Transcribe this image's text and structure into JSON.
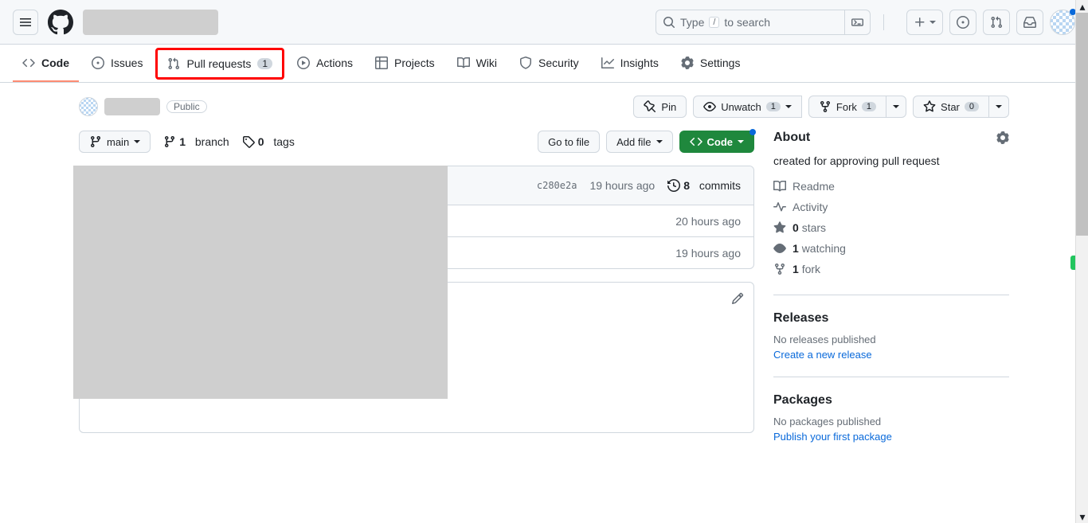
{
  "topbar": {
    "search_placeholder": "Type",
    "search_suffix": "to search",
    "search_key": "/"
  },
  "nav": {
    "code": "Code",
    "issues": "Issues",
    "pulls": "Pull requests",
    "pulls_count": "1",
    "actions": "Actions",
    "projects": "Projects",
    "wiki": "Wiki",
    "security": "Security",
    "insights": "Insights",
    "settings": "Settings"
  },
  "repo": {
    "visibility": "Public",
    "pin": "Pin",
    "unwatch": "Unwatch",
    "unwatch_count": "1",
    "fork": "Fork",
    "fork_count": "1",
    "star": "Star",
    "star_count": "0"
  },
  "toolbar": {
    "branch": "main",
    "branches_n": "1",
    "branches": "branch",
    "tags_n": "0",
    "tags": "tags",
    "goto": "Go to file",
    "addfile": "Add file",
    "code": "Code"
  },
  "commits": {
    "sha": "c280e2a",
    "time": "19 hours ago",
    "count": "8",
    "label": "commits"
  },
  "rows": {
    "r1_time": "20 hours ago",
    "r2_time": "19 hours ago"
  },
  "about": {
    "title": "About",
    "description": "created for approving pull request",
    "readme": "Readme",
    "activity": "Activity",
    "stars_n": "0",
    "stars": "stars",
    "watch_n": "1",
    "watch": "watching",
    "forks_n": "1",
    "forks": "fork"
  },
  "releases": {
    "title": "Releases",
    "empty": "No releases published",
    "link": "Create a new release"
  },
  "packages": {
    "title": "Packages",
    "empty": "No packages published",
    "link": "Publish your first package"
  }
}
